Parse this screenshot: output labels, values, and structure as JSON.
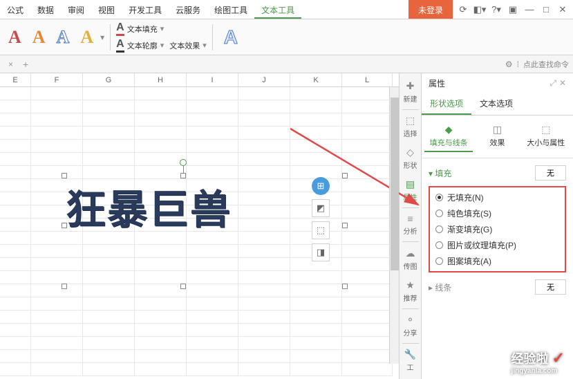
{
  "menu": {
    "items": [
      "公式",
      "数据",
      "审阅",
      "视图",
      "开发工具",
      "云服务",
      "绘图工具",
      "文本工具"
    ],
    "active_index": 7,
    "login": "未登录"
  },
  "ribbon": {
    "text_fill": "文本填充",
    "text_outline": "文本轮廓",
    "text_effect": "文本效果"
  },
  "search": {
    "hint": "点此查找命令"
  },
  "columns": [
    "E",
    "F",
    "G",
    "H",
    "I",
    "J",
    "K",
    "L"
  ],
  "wordart": {
    "text": "狂暴巨兽"
  },
  "side_tools": [
    "新建",
    "选择",
    "形状",
    "属性",
    "分析",
    "传图",
    "推荐",
    "分享",
    "工"
  ],
  "panel": {
    "title": "属性",
    "tabs": [
      "形状选项",
      "文本选项"
    ],
    "active_tab": 0,
    "subtabs": [
      "填充与线条",
      "效果",
      "大小与属性"
    ],
    "active_subtab": 0,
    "fill_section": "填充",
    "line_section": "线条",
    "none_btn": "无",
    "fill_options": [
      {
        "label": "无填充(N)",
        "checked": true
      },
      {
        "label": "纯色填充(S)",
        "checked": false
      },
      {
        "label": "渐变填充(G)",
        "checked": false
      },
      {
        "label": "图片或纹理填充(P)",
        "checked": false
      },
      {
        "label": "图案填充(A)",
        "checked": false
      }
    ]
  },
  "watermark": {
    "main": "经验啦",
    "sub": "jingyanla.com"
  }
}
